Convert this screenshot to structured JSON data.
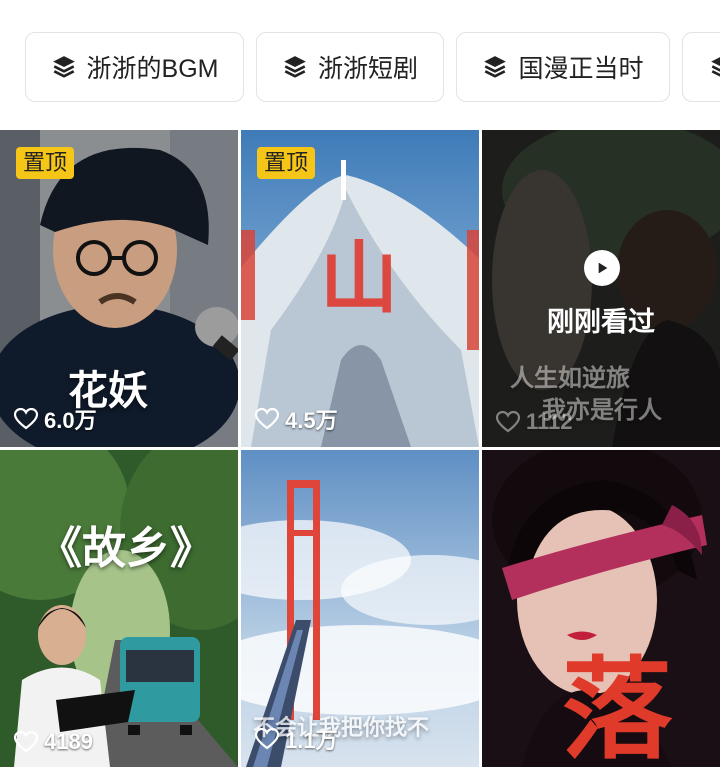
{
  "chips": [
    {
      "icon": "layers-icon",
      "label": "浙浙的BGM"
    },
    {
      "icon": "layers-icon",
      "label": "浙浙短剧"
    },
    {
      "icon": "layers-icon",
      "label": "国漫正当时"
    }
  ],
  "videos": [
    {
      "pinned": "置顶",
      "likes": "6.0万",
      "caption": "花妖"
    },
    {
      "pinned": "置顶",
      "likes": "4.5万",
      "caption": "山"
    },
    {
      "status": "刚刚看过",
      "likes": "1112",
      "caption_line1": "人生如逆旅",
      "caption_line2": "我亦是行人"
    },
    {
      "likes": "4189",
      "caption": "《故乡》"
    },
    {
      "likes": "1.1万",
      "caption": "不会让我把你找不"
    },
    {
      "caption": "落"
    }
  ]
}
